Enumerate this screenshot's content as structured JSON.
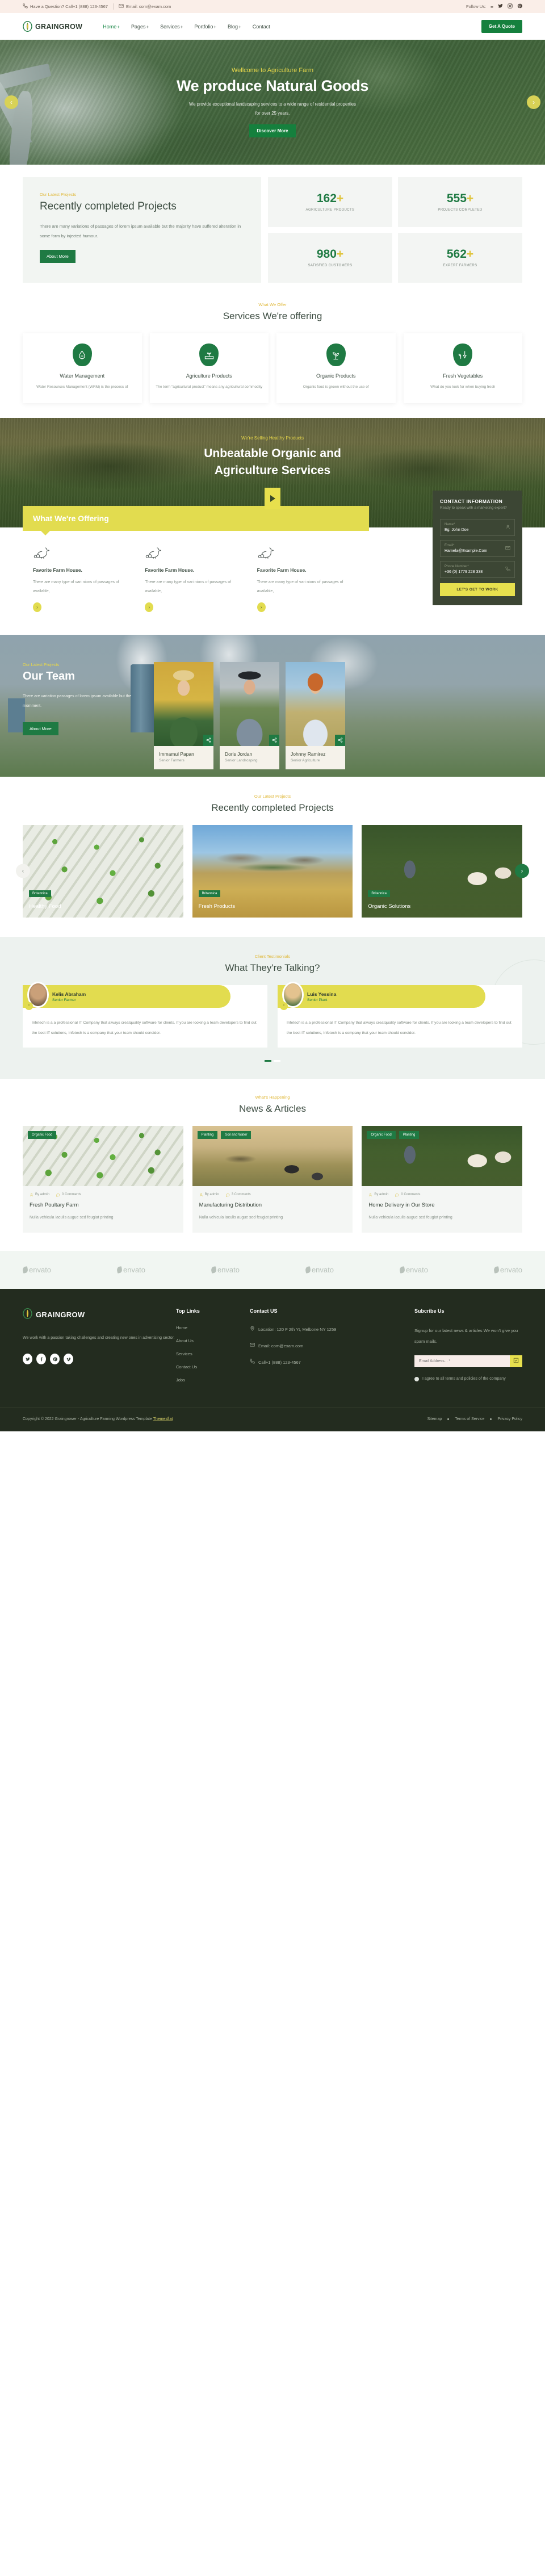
{
  "topbar": {
    "phone": "Have a Question? Call+1 (888) 123-4567",
    "email": "Email: com@exam.com",
    "follow_label": "Follow Us:",
    "socials": [
      "facebook-icon",
      "twitter-icon",
      "instagram-icon",
      "pinterest-icon"
    ]
  },
  "nav": {
    "brand": "GRAINGROW",
    "links": [
      {
        "label": "Home",
        "plus": "+",
        "active": true
      },
      {
        "label": "Pages",
        "plus": "+",
        "active": false
      },
      {
        "label": "Services",
        "plus": "+",
        "active": false
      },
      {
        "label": "Portfolio",
        "plus": "+",
        "active": false
      },
      {
        "label": "Blog",
        "plus": "+",
        "active": false
      },
      {
        "label": "Contact",
        "plus": "",
        "active": false
      }
    ],
    "cta": "Get A Quote"
  },
  "hero": {
    "eyebrow": "Wellcome to Agriculture Farm",
    "title": "We produce Natural Goods",
    "desc": "We provide exceptional landscaping services to a wide range of residential properties for over 25 years.",
    "button": "Discover More",
    "prev": "‹",
    "next": "›"
  },
  "stats": {
    "eyebrow": "Our Latest Projects",
    "title": "Recently completed Projects",
    "desc": "There are many variations of passages of lorem ipsum available but the majority have suffered alteration in some form by injected humour.",
    "button": "About More",
    "items": [
      {
        "value": "162",
        "plus": "+",
        "label": "AGRICULTURE PRODUCTS"
      },
      {
        "value": "555",
        "plus": "+",
        "label": "PROJECTS COMPLETED"
      },
      {
        "value": "980",
        "plus": "+",
        "label": "SATISFIED CUSTOMERS"
      },
      {
        "value": "562",
        "plus": "+",
        "label": "EXPERT FARMERS"
      }
    ]
  },
  "services": {
    "eyebrow": "What We Offer",
    "title": "Services We're offering",
    "cards": [
      {
        "icon": "water-drop-icon",
        "title": "Water Management",
        "desc": "Water Resources Management (WRM) is the process of"
      },
      {
        "icon": "seedling-tray-icon",
        "title": "Agriculture Products",
        "desc": "The term “agricultural product” means any agricultural commodity"
      },
      {
        "icon": "plant-leaf-icon",
        "title": "Organic Products",
        "desc": "Organic food is grown without the use of"
      },
      {
        "icon": "shovel-plant-icon",
        "title": "Fresh Vegetables",
        "desc": "What do you look for when buying fresh"
      }
    ]
  },
  "video": {
    "eyebrow": "We're Selling Healthy Products",
    "title_line1": "Unbeatable Organic and",
    "title_line2": "Agriculture Services",
    "play": "play-icon"
  },
  "offering": {
    "banner": "What We're Offering",
    "cards": [
      {
        "icon": "goose-icon",
        "title": "Favorite Farm House.",
        "desc": "There are many type of vari nions of passages of available,",
        "arrow": "›"
      },
      {
        "icon": "goose-icon",
        "title": "Favorite Farm House.",
        "desc": "There are many type of vari nions of passages of available,",
        "arrow": "›"
      },
      {
        "icon": "goose-icon",
        "title": "Favorite Farm House.",
        "desc": "There are many type of vari nions of passages of available,",
        "arrow": "›"
      }
    ]
  },
  "contact": {
    "title": "CONTACT INFORMATION",
    "subtitle": "Ready to speak with a marketing expert?",
    "fields": [
      {
        "label": "Name*",
        "value": "Eg: John Doe",
        "icon": "user-icon"
      },
      {
        "label": "Email*",
        "value": "Hamela@Example.Com",
        "icon": "envelope-icon"
      },
      {
        "label": "Phone Number*",
        "value": "+36 (0) 1779 228 338",
        "icon": "phone-icon"
      }
    ],
    "button": "LET'S GET TO WORK"
  },
  "team": {
    "eyebrow": "Our Latest Projects",
    "title": "Our Team",
    "desc": "There are variation passages of lorem ipsum available but the momment.",
    "button": "About More",
    "members": [
      {
        "name": "Immamul Papan",
        "role": "Senior Farmers",
        "share": "share-icon"
      },
      {
        "name": "Doris Jordan",
        "role": "Senior Landscaping",
        "share": "share-icon"
      },
      {
        "name": "Johnny Ramirez",
        "role": "Senior Agriculture",
        "share": "share-icon"
      }
    ]
  },
  "projects": {
    "eyebrow": "Our Latest Projects",
    "title": "Recently completed Projects",
    "prev": "‹",
    "next": "›",
    "items": [
      {
        "tag": "Britannica",
        "title": "Healthy Food"
      },
      {
        "tag": "Britannica",
        "title": "Fresh Products"
      },
      {
        "tag": "Britannica",
        "title": "Organic Solutions"
      }
    ]
  },
  "testimonials": {
    "eyebrow": "Client Testimonials",
    "title": "What They're Talking?",
    "items": [
      {
        "name": "Kelis Abraham",
        "role": "Senior Farmer",
        "quote_icon": "quote-icon",
        "text": "Infetech is a a professional IT Company that always creatquality software for clients. If you are looking a team developers to find out the best IT solutions, Infetech is a company that your team should consider."
      },
      {
        "name": "Luis Yessina",
        "role": "Senior Plant",
        "quote_icon": "quote-icon",
        "text": "Infetech is a a professional IT Company that always creatquality software for clients. If you are looking a team developers to find out the best IT solutions, Infetech is a company that your team should consider."
      }
    ]
  },
  "news": {
    "eyebrow": "What's Happening",
    "title": "News & Articles",
    "items": [
      {
        "tags": [
          "Organic Food"
        ],
        "author": "By admin",
        "comments": "0 Comments",
        "title": "Fresh Poultary Farm",
        "desc": "Nulla vehicula iaculis augue sed feugiat printing"
      },
      {
        "tags": [
          "Planting",
          "Soil and Water"
        ],
        "author": "By admin",
        "comments": "3 Comments",
        "title": "Manufacturing Distribution",
        "desc": "Nulla vehicula iaculis augue sed feugiat printing"
      },
      {
        "tags": [
          "Organic Food",
          "Planting"
        ],
        "author": "By admin",
        "comments": "0 Comments",
        "title": "Home Delivery in Our Store",
        "desc": "Nulla vehicula iaculis augue sed feugiat printing"
      }
    ]
  },
  "brands": {
    "items": [
      "envato",
      "envato",
      "envato",
      "envato",
      "envato",
      "envato"
    ]
  },
  "footer": {
    "brand": "GRAINGROW",
    "desc": "We work with a passion taking challenges and creating new ones in advertising sector.",
    "socials": [
      "twitter-icon",
      "facebook-icon",
      "pinterest-icon",
      "vimeo-icon"
    ],
    "top_links_title": "Top Links",
    "top_links": [
      "Home",
      "About Us",
      "Services",
      "Contact Us",
      "Jobs"
    ],
    "contact_title": "Contact US",
    "contact_items": [
      {
        "icon": "location-icon",
        "text": "Location: 120 F 2th Yt, Melbone NY 1259"
      },
      {
        "icon": "envelope-icon",
        "text": "Email: com@exam.com"
      },
      {
        "icon": "phone-icon",
        "text": "Call+1 (888) 123-4567"
      }
    ],
    "subscribe_title": "Subcribe Us",
    "subscribe_desc": "Signup for our latest news & articles We won't give you spam mails.",
    "email_placeholder": "Email Address... *",
    "submit_icon": "send-icon",
    "agree_text": "I agree to all terms and policies of the company"
  },
  "copyright": {
    "text": "Copyright © 2022 Graingrower - Agriculture Farming Wordpress Template",
    "link": "Themesflat",
    "links": [
      "Sitemap",
      "Terms of Service",
      "Privacy Policy"
    ]
  },
  "colors": {
    "green": "#1f7a43",
    "yellow": "#e2dc4f",
    "dark": "#232c1f"
  }
}
